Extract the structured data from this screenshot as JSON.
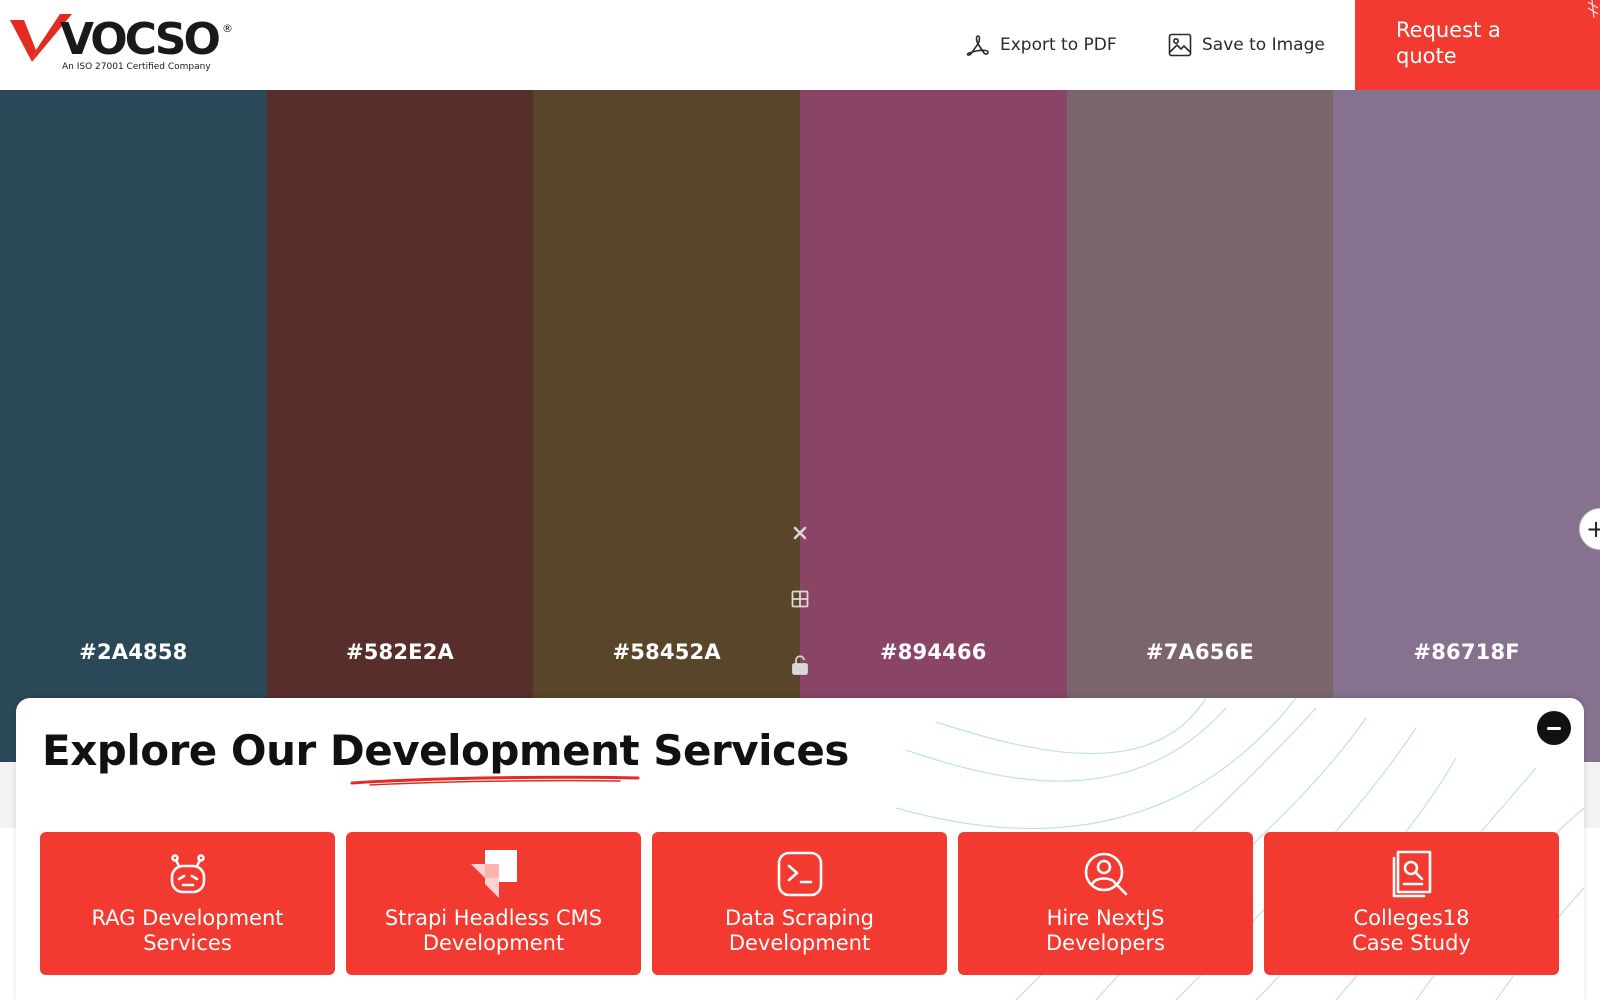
{
  "brand": {
    "name": "VOCSO",
    "registered_mark": "®",
    "tagline": "An ISO 27001 Certified Company",
    "accent_color": "#f23a30"
  },
  "header": {
    "export_pdf": {
      "label": "Export to PDF",
      "icon": "acrobat-icon"
    },
    "save_image": {
      "label": "Save to Image",
      "icon": "image-icon"
    },
    "quote_button": {
      "line1": "Request a",
      "line2": "quote"
    }
  },
  "palette": {
    "swatches": [
      {
        "hex": "#2A4858",
        "label": "#2A4858"
      },
      {
        "hex": "#582E2A",
        "label": "#582E2A"
      },
      {
        "hex": "#58452A",
        "label": "#58452A"
      },
      {
        "hex": "#894466",
        "label": "#894466"
      },
      {
        "hex": "#7A656E",
        "label": "#7A656E"
      },
      {
        "hex": "#86718F",
        "label": "#86718F"
      }
    ],
    "tools": [
      "close-icon",
      "grid-icon",
      "unlock-icon"
    ],
    "add_button_icon": "plus-icon"
  },
  "explore": {
    "title_part1": "Explore Our ",
    "title_highlight": "Development",
    "title_part2": " Services",
    "collapse_icon": "minus-icon",
    "cards": [
      {
        "line1": "RAG Development",
        "line2": "Services",
        "icon": "robot-icon"
      },
      {
        "line1": "Strapi Headless CMS",
        "line2": "Development",
        "icon": "strapi-icon"
      },
      {
        "line1": "Data Scraping",
        "line2": "Development",
        "icon": "terminal-icon"
      },
      {
        "line1": "Hire NextJS",
        "line2": "Developers",
        "icon": "user-search-icon"
      },
      {
        "line1": "Colleges18",
        "line2": "Case Study",
        "icon": "document-search-icon"
      }
    ]
  }
}
